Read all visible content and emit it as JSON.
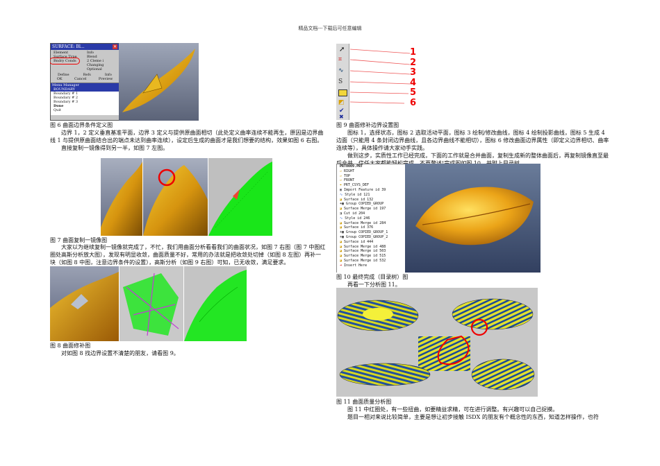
{
  "header": "精品文档---下载后可任意编辑",
  "fig6": {
    "caption": "图 6 曲面边界条件定义图",
    "dialog": {
      "title": "SURFACE: Bl...",
      "col1": "Element",
      "col2": "Info",
      "rows": [
        {
          "a": "Surface Type",
          "b": "Blend"
        },
        {
          "a": "Bndry Conds",
          "b": "2 Cleme i"
        },
        {
          "a": "",
          "b": "Changing"
        },
        {
          "a": "",
          "b": "Optional"
        }
      ],
      "btns_row1": [
        "Define",
        "Refs",
        "Info"
      ],
      "btns_row2": [
        "OK",
        "Cancel",
        "Preview"
      ],
      "menu_title": "Menu Manager",
      "menu_items": [
        "BOUNDARY",
        "Boundary # 1",
        "Boundary # 2",
        "Boundary # 3",
        "Done",
        "Quit"
      ]
    }
  },
  "para1": "边界 1，2 定义垂直基准平面，边界 3 定义与提供原曲面相切（此处定义曲率连续不能再生，原因是边界曲线 1 与提供原曲面结合出的端点未达到曲率连续），设定后生成的曲面才是我们想要的结构，效果如图 6 右图。",
  "para2": "直接复制一镜像得到另一半，如图 7 左图。",
  "fig7": {
    "caption": "图 7 曲面复制一镜像图"
  },
  "para3": "大家以为继续复制一镜像就完成了，不忙，我们用曲面分析看看我们的曲面状况，如图 7 右图（图 7 中图红圈处高斯分析放大图），发现有明显收敛，曲面质量不好，常用的办法就是把收敛处切掉（如图 8 左图）再补一块（如图 8 中图，注意边界条件的设置），高斯分析（如图 9 右图）可知，已无收敛，满足要求。",
  "fig8": {
    "caption": "图 8 曲面修补图"
  },
  "para4": "对如图 8 找边界设置不清楚的朋友，请看图 9。",
  "fig9": {
    "caption": "图 9 曲面修补边界设置图",
    "numbers": [
      "1",
      "2",
      "3",
      "4",
      "5",
      "6"
    ]
  },
  "para5": "图标 1，选择状态，图标 2 选取活动平面，图标 3 绘制/修改曲线，图标 4 绘制投影曲线，图标 5 生成 4 边面（只能用 4 条封闭边界曲线，且各边界曲线不能相切），图标 6 修改曲面边界属性（即定义边界相切、曲率连续等），具体操作请大家动手实践。",
  "para6": "做到这步，实质性工作已经完成，下面的工作就是合并曲面，复制生成新的整体曲面后，再复制镜像直至最后合并，信任大家都能轻松完成，不再赘述!完成图如图 10，并附上目录树。",
  "fig10": {
    "caption": "图 10 最终完成（目录树）图",
    "tree": [
      "PRT0009.PRT",
      "RIGHT",
      "TOP",
      "FRONT",
      "PRT_CSYS_DEF",
      "Import Feature id 39",
      "Style id 121",
      "Surface id 132",
      "Group COPIED_GROUP",
      "Surface Merge id 197",
      "Cut id 204",
      "Style id 246",
      "Surface Merge id 284",
      "Surface id 376",
      "Group COPIED_GROUP_1",
      "Group COPIED_GROUP_2",
      "Surface id 444",
      "Surface Merge id 488",
      "Surface Merge id 503",
      "Surface Merge id 515",
      "Surface Merge id 532",
      "Insert Here"
    ]
  },
  "para7": "再看一下分析图 11。",
  "fig11": {
    "caption": "图 11 曲面质量分析图"
  },
  "para8": "图 11 中红圈处，有一些扭曲，如要精益求精，可在进行调整。有兴趣可以自己捉摸。",
  "para9": "题目一相对来说比较简单，主要是想让初步接触 ISDX 的朋友有个概念性的东西，知道怎样操作，也符"
}
